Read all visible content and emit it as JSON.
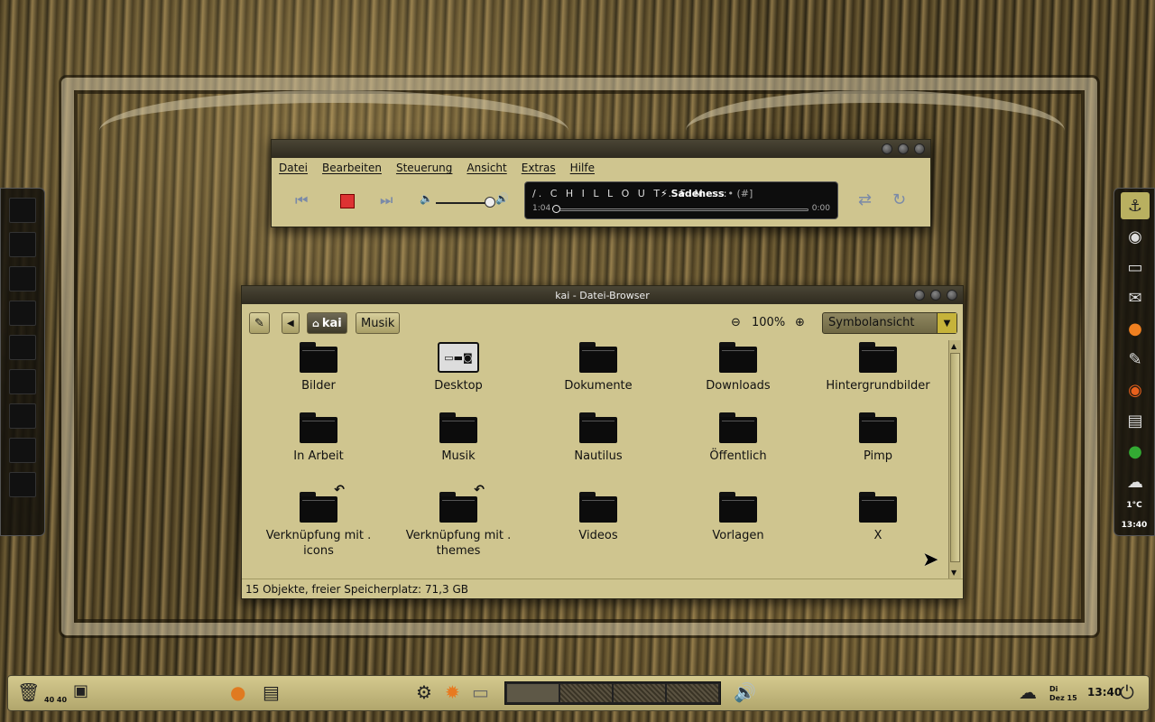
{
  "player": {
    "menu": [
      "Datei",
      "Bearbeiten",
      "Steuerung",
      "Ansicht",
      "Extras",
      "Hilfe"
    ],
    "station": "/. C H I L L O U T . F M :::",
    "song": "Sadeness",
    "song_suffix": "• (#]",
    "elapsed": "1:04",
    "remaining": "0:00",
    "progress_fraction": 0.0,
    "volume_fraction": 0.9
  },
  "browser": {
    "title": "kai - Datei-Browser",
    "path": [
      "kai",
      "Musik"
    ],
    "zoom": "100%",
    "view_mode": "Symbolansicht",
    "items": [
      {
        "name": "Bilder"
      },
      {
        "name": "Desktop"
      },
      {
        "name": "Dokumente"
      },
      {
        "name": "Downloads"
      },
      {
        "name": "Hintergrundbilder"
      },
      {
        "name": "In Arbeit"
      },
      {
        "name": "Musik"
      },
      {
        "name": "Nautilus"
      },
      {
        "name": "Öffentlich"
      },
      {
        "name": "Pimp"
      },
      {
        "name": "Verknüpfung mit .\nicons"
      },
      {
        "name": "Verknüpfung mit .\nthemes"
      },
      {
        "name": "Videos"
      },
      {
        "name": "Vorlagen"
      },
      {
        "name": "X"
      }
    ],
    "status": "15 Objekte, freier Speicherplatz: 71,3 GB"
  },
  "dock_right": {
    "temperature": "1°C",
    "time": "13:40"
  },
  "panel": {
    "cpu_values": "40 40",
    "day": "Di",
    "date": "Dez 15",
    "time": "13:40"
  },
  "colors": {
    "window_bg": "#cfc58f",
    "titlebar": "#2f2b1f",
    "stop_red": "#dd3333"
  }
}
